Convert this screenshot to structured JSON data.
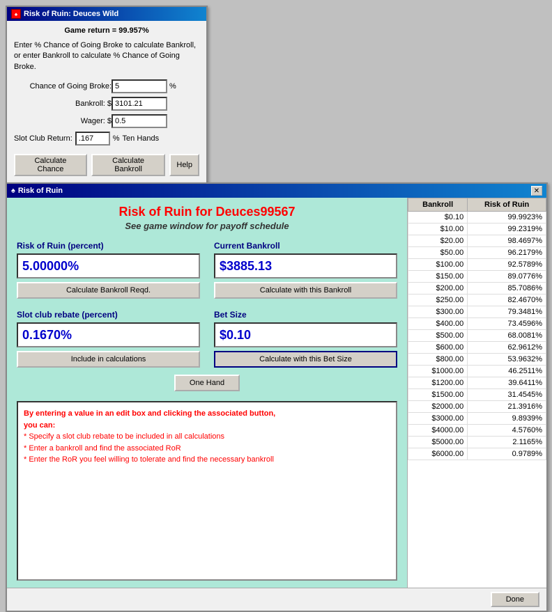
{
  "small_window": {
    "title": "Risk of Ruin: Deuces Wild",
    "game_return": "Game return = 99.957%",
    "description": "Enter % Chance of Going Broke to calculate Bankroll, or enter Bankroll to calculate % Chance of Going Broke.",
    "chance_label": "Chance of Going Broke:",
    "chance_value": "5",
    "bankroll_label": "Bankroll: $",
    "bankroll_value": "3101.21",
    "wager_label": "Wager: $",
    "wager_value": "0.5",
    "slot_label": "Slot Club Return:",
    "slot_value": ".167",
    "slot_pct": "%",
    "slot_text": "Ten Hands",
    "btn_calculate_chance": "Calculate Chance",
    "btn_calculate_bankroll": "Calculate Bankroll",
    "btn_help": "Help",
    "pct_symbol": "%"
  },
  "large_window": {
    "title": "Risk of Ruin",
    "title_icon": "♠",
    "close_btn": "✕",
    "ror_title": "Risk of Ruin for Deuces99567",
    "subtitle": "See game window for payoff schedule",
    "ror_percent_label": "Risk of Ruin (percent)",
    "ror_percent_value": "5.00000%",
    "current_bankroll_label": "Current Bankroll",
    "current_bankroll_value": "$3885.13",
    "btn_calc_bankroll_reqd": "Calculate Bankroll Reqd.",
    "btn_calc_with_bankroll": "Calculate with this Bankroll",
    "slot_rebate_label": "Slot club rebate (percent)",
    "slot_rebate_value": "0.1670%",
    "bet_size_label": "Bet Size",
    "bet_size_value": "$0.10",
    "btn_include_calc": "Include in calculations",
    "btn_calc_bet_size": "Calculate with this Bet Size",
    "btn_one_hand": "One Hand",
    "info_text_line1": "By entering a value in an edit box and clicking the associated button,",
    "info_text_line2": "you can:",
    "info_text_line3": "* Specify a slot club rebate to be included in all calculations",
    "info_text_line4": "* Enter a bankroll and find the associated RoR",
    "info_text_line5": "* Enter the RoR you feel willing to tolerate and find the necessary bankroll",
    "btn_done": "Done",
    "table": {
      "col_bankroll": "Bankroll",
      "col_ror": "Risk of Ruin",
      "rows": [
        {
          "bankroll": "$0.10",
          "ror": "99.9923%"
        },
        {
          "bankroll": "$10.00",
          "ror": "99.2319%"
        },
        {
          "bankroll": "$20.00",
          "ror": "98.4697%"
        },
        {
          "bankroll": "$50.00",
          "ror": "96.2179%"
        },
        {
          "bankroll": "$100.00",
          "ror": "92.5789%"
        },
        {
          "bankroll": "$150.00",
          "ror": "89.0776%"
        },
        {
          "bankroll": "$200.00",
          "ror": "85.7086%"
        },
        {
          "bankroll": "$250.00",
          "ror": "82.4670%"
        },
        {
          "bankroll": "$300.00",
          "ror": "79.3481%"
        },
        {
          "bankroll": "$400.00",
          "ror": "73.4596%"
        },
        {
          "bankroll": "$500.00",
          "ror": "68.0081%"
        },
        {
          "bankroll": "$600.00",
          "ror": "62.9612%"
        },
        {
          "bankroll": "$800.00",
          "ror": "53.9632%"
        },
        {
          "bankroll": "$1000.00",
          "ror": "46.2511%"
        },
        {
          "bankroll": "$1200.00",
          "ror": "39.6411%"
        },
        {
          "bankroll": "$1500.00",
          "ror": "31.4545%"
        },
        {
          "bankroll": "$2000.00",
          "ror": "21.3916%"
        },
        {
          "bankroll": "$3000.00",
          "ror": "9.8939%"
        },
        {
          "bankroll": "$4000.00",
          "ror": "4.5760%"
        },
        {
          "bankroll": "$5000.00",
          "ror": "2.1165%"
        },
        {
          "bankroll": "$6000.00",
          "ror": "0.9789%"
        }
      ]
    }
  }
}
